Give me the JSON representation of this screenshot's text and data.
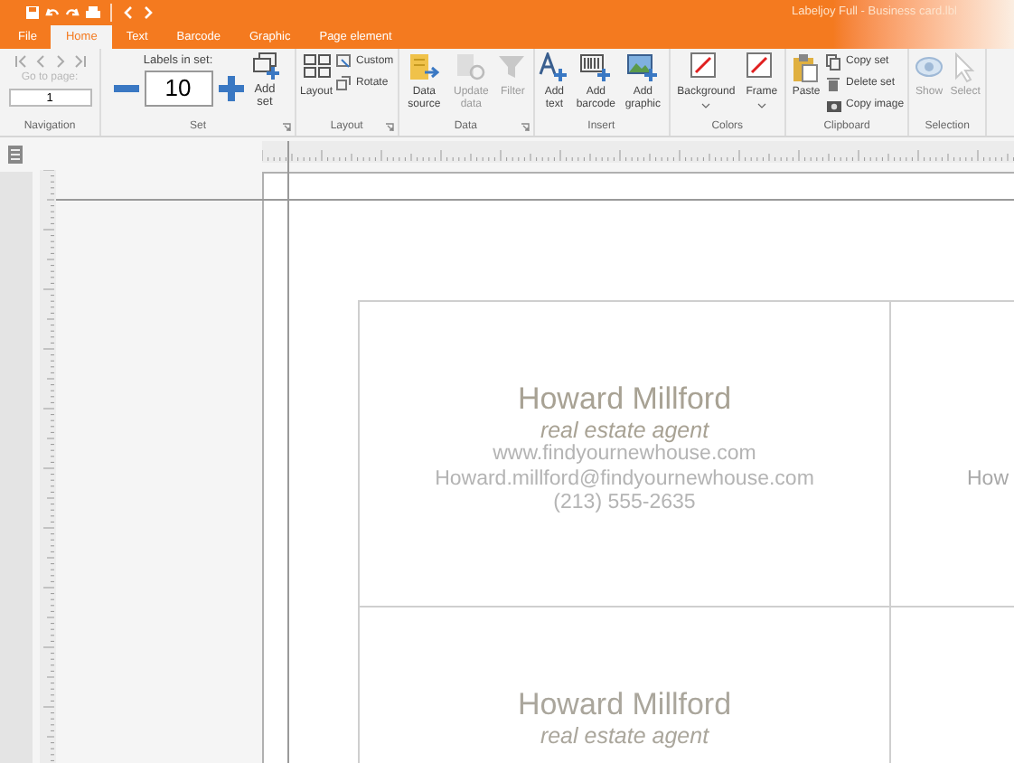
{
  "window": {
    "title": "Labeljoy Full - Business card.lbl"
  },
  "tabs": [
    {
      "label": "File",
      "selected": false
    },
    {
      "label": "Home",
      "selected": true
    },
    {
      "label": "Text",
      "selected": false
    },
    {
      "label": "Barcode",
      "selected": false
    },
    {
      "label": "Graphic",
      "selected": false
    },
    {
      "label": "Page element",
      "selected": false
    }
  ],
  "ribbon": {
    "navigation": {
      "label": "Navigation",
      "go_to_label": "Go to page:",
      "page_value": "1"
    },
    "set": {
      "label": "Set",
      "count_label": "Labels in set:",
      "count": "10",
      "add_label": "Add set",
      "launcher": true
    },
    "groups": [
      {
        "label": "Layout",
        "launcher": true,
        "items": [
          {
            "kind": "large",
            "label": "Layout",
            "disabled": false
          },
          {
            "kind": "small",
            "label": "Custom",
            "disabled": false
          },
          {
            "kind": "small",
            "label": "Rotate",
            "disabled": false
          }
        ]
      },
      {
        "label": "Data",
        "launcher": true,
        "items": [
          {
            "kind": "large",
            "label": "Data source",
            "disabled": false
          },
          {
            "kind": "large",
            "label": "Update data",
            "disabled": true
          },
          {
            "kind": "large",
            "label": "Filter",
            "disabled": true
          }
        ]
      },
      {
        "label": "Insert",
        "items": [
          {
            "kind": "large",
            "label": "Add text",
            "disabled": false
          },
          {
            "kind": "large",
            "label": "Add barcode",
            "disabled": false
          },
          {
            "kind": "large",
            "label": "Add graphic",
            "disabled": false
          }
        ]
      },
      {
        "label": "Colors",
        "items": [
          {
            "kind": "color",
            "label": "Background",
            "disabled": false
          },
          {
            "kind": "color",
            "label": "Frame",
            "disabled": false
          }
        ]
      },
      {
        "label": "Clipboard",
        "items": [
          {
            "kind": "large",
            "label": "Paste",
            "disabled": false
          },
          {
            "kind": "small",
            "label": "Copy set",
            "disabled": false
          },
          {
            "kind": "small",
            "label": "Delete set",
            "disabled": false
          },
          {
            "kind": "small",
            "label": "Copy image",
            "disabled": false
          }
        ]
      },
      {
        "label": "Selection",
        "items": [
          {
            "kind": "large",
            "label": "Show",
            "disabled": true
          },
          {
            "kind": "large",
            "label": "Select",
            "disabled": true
          }
        ]
      }
    ]
  },
  "cards": [
    {
      "lines": [
        {
          "kind": "name",
          "text": "Howard Millford"
        },
        {
          "kind": "title",
          "text": "real estate agent"
        },
        {
          "kind": "contact",
          "text": "www.findyournewhouse.com"
        },
        {
          "kind": "contact",
          "text": "Howard.millford@findyournewhouse.com"
        },
        {
          "kind": "contact",
          "text": "(213) 555-2635"
        }
      ]
    },
    {
      "lines": [
        {
          "kind": "contact",
          "text": "How"
        }
      ]
    },
    {
      "lines": [
        {
          "kind": "name",
          "text": "Howard Millford"
        },
        {
          "kind": "title",
          "text": "real estate agent"
        }
      ]
    }
  ]
}
